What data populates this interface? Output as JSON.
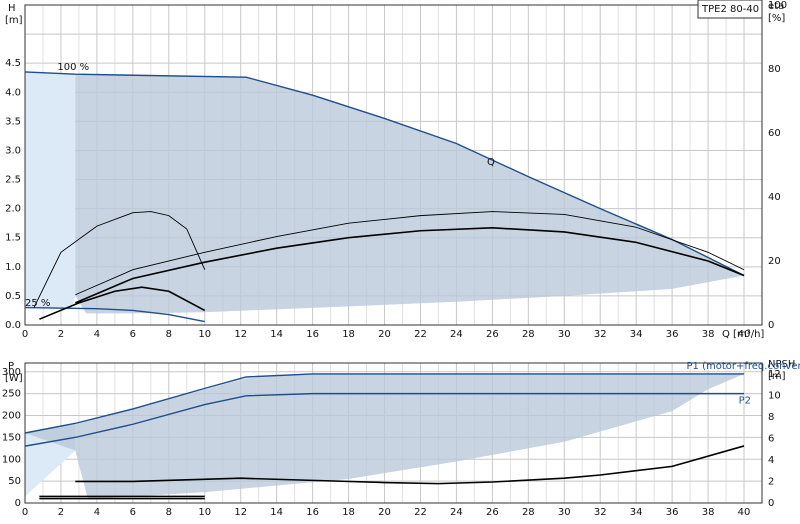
{
  "pump_model": "TPE2 80-40",
  "chart_data": [
    {
      "type": "line",
      "panel": "head",
      "x_label": "Q [m³/h]",
      "x_ticks": [
        0,
        2,
        4,
        6,
        8,
        10,
        12,
        14,
        16,
        18,
        20,
        22,
        24,
        26,
        28,
        30,
        32,
        34,
        36,
        38,
        40
      ],
      "xlim": [
        0,
        41
      ],
      "y_label_line1": "H",
      "y_label_line2": "[m]",
      "y_ticks": [
        0.0,
        0.5,
        1.0,
        1.5,
        2.0,
        2.5,
        3.0,
        3.5,
        4.0,
        4.5
      ],
      "ylim": [
        0,
        5.5
      ],
      "y2_label_line1": "eta",
      "y2_label_line2": "[%]",
      "y2_ticks": [
        0,
        20,
        40,
        60,
        80,
        100
      ],
      "y2lim": [
        0,
        100
      ],
      "annotations": [
        {
          "text": "100 %",
          "x": 1.8,
          "y": 4.38
        },
        {
          "text": "25 %",
          "x": 0.0,
          "y": 0.33
        },
        {
          "text": "Q",
          "x": 25.7,
          "y": 2.75
        }
      ],
      "region_boundary": [
        [
          2.8,
          4.31
        ],
        [
          12.3,
          4.26
        ],
        [
          16,
          3.95
        ],
        [
          20,
          3.55
        ],
        [
          24,
          3.12
        ],
        [
          28,
          2.55
        ],
        [
          32,
          2.0
        ],
        [
          36,
          1.47
        ],
        [
          40,
          0.85
        ],
        [
          36,
          0.62
        ],
        [
          30,
          0.5
        ],
        [
          24,
          0.4
        ],
        [
          18,
          0.32
        ],
        [
          10,
          0.22
        ],
        [
          6,
          0.2
        ],
        [
          3.4,
          0.2
        ],
        [
          2.8,
          0.5
        ],
        [
          2.8,
          4.31
        ]
      ],
      "series": [
        {
          "role": "max_curve",
          "points": [
            [
              0,
              4.35
            ],
            [
              2.8,
              4.31
            ],
            [
              12.3,
              4.26
            ],
            [
              16,
              3.95
            ],
            [
              20,
              3.55
            ],
            [
              24,
              3.12
            ],
            [
              28,
              2.55
            ],
            [
              32,
              2.0
            ],
            [
              36,
              1.47
            ],
            [
              40,
              0.85
            ]
          ]
        },
        {
          "role": "min_curve",
          "points": [
            [
              0,
              0.3
            ],
            [
              4,
              0.28
            ],
            [
              6,
              0.25
            ],
            [
              8,
              0.18
            ],
            [
              10,
              0.06
            ]
          ]
        },
        {
          "role": "eta_p1",
          "points": [
            [
              2.8,
              0.38
            ],
            [
              6,
              0.8
            ],
            [
              10,
              1.08
            ],
            [
              14,
              1.32
            ],
            [
              18,
              1.5
            ],
            [
              22,
              1.62
            ],
            [
              26,
              1.67
            ],
            [
              30,
              1.6
            ],
            [
              34,
              1.42
            ],
            [
              38,
              1.1
            ],
            [
              40,
              0.85
            ]
          ]
        },
        {
          "role": "eta_p2",
          "points": [
            [
              2.8,
              0.52
            ],
            [
              6,
              0.95
            ],
            [
              10,
              1.25
            ],
            [
              14,
              1.52
            ],
            [
              18,
              1.75
            ],
            [
              22,
              1.88
            ],
            [
              26,
              1.95
            ],
            [
              30,
              1.9
            ],
            [
              34,
              1.68
            ],
            [
              38,
              1.25
            ],
            [
              40,
              0.95
            ]
          ]
        },
        {
          "role": "eta_p1_min",
          "points": [
            [
              0.8,
              0.1
            ],
            [
              3,
              0.38
            ],
            [
              5,
              0.58
            ],
            [
              6.5,
              0.65
            ],
            [
              8,
              0.58
            ],
            [
              10,
              0.25
            ]
          ]
        },
        {
          "role": "eta_p2_min",
          "points": [
            [
              0.5,
              0.3
            ],
            [
              2,
              1.25
            ],
            [
              4,
              1.7
            ],
            [
              6,
              1.93
            ],
            [
              7,
              1.95
            ],
            [
              8,
              1.88
            ],
            [
              9,
              1.65
            ],
            [
              10,
              0.95
            ]
          ]
        }
      ]
    },
    {
      "type": "line",
      "panel": "power",
      "x_ticks": [
        0,
        2,
        4,
        6,
        8,
        10,
        12,
        14,
        16,
        18,
        20,
        22,
        24,
        26,
        28,
        30,
        32,
        34,
        36,
        38,
        40
      ],
      "xlim": [
        0,
        41
      ],
      "y_label_line1": "P",
      "y_label_line2": "[W]",
      "y_ticks": [
        0,
        50,
        100,
        150,
        200,
        250,
        300
      ],
      "ylim": [
        0,
        320
      ],
      "y2_label_line1": "NPSH",
      "y2_label_line2": "[m]",
      "y2_ticks": [
        0,
        2,
        4,
        6,
        8,
        10,
        12
      ],
      "y2lim": [
        0,
        13
      ],
      "legend": [
        {
          "text": "P1 (motor+freq.converter)",
          "x": 36.8,
          "y": 306
        },
        {
          "text": "P2",
          "x": 39.7,
          "y": 228
        }
      ],
      "region_boundary": [
        [
          0,
          160
        ],
        [
          2.8,
          180
        ],
        [
          12.3,
          285
        ],
        [
          16,
          295
        ],
        [
          40,
          295
        ],
        [
          38,
          260
        ],
        [
          36,
          210
        ],
        [
          30,
          140
        ],
        [
          24,
          95
        ],
        [
          18,
          55
        ],
        [
          10,
          25
        ],
        [
          6,
          15
        ],
        [
          3.5,
          8
        ],
        [
          2.8,
          120
        ],
        [
          0,
          160
        ]
      ],
      "series": [
        {
          "role": "P1",
          "points": [
            [
              0,
              160
            ],
            [
              2.8,
              182
            ],
            [
              6,
              215
            ],
            [
              10,
              262
            ],
            [
              12.3,
              288
            ],
            [
              16,
              295
            ],
            [
              40,
              295
            ]
          ]
        },
        {
          "role": "P2",
          "points": [
            [
              0,
              130
            ],
            [
              2.8,
              150
            ],
            [
              6,
              180
            ],
            [
              10,
              225
            ],
            [
              12.3,
              245
            ],
            [
              16,
              250
            ],
            [
              38,
              250
            ],
            [
              40,
              250
            ]
          ]
        },
        {
          "role": "P1_min",
          "points": [
            [
              0.8,
              15
            ],
            [
              10,
              15
            ]
          ]
        },
        {
          "role": "P2_min",
          "points": [
            [
              0.8,
              10
            ],
            [
              10,
              10
            ]
          ]
        },
        {
          "role": "NPSH",
          "points": [
            [
              2.8,
              2.0
            ],
            [
              6,
              2.0
            ],
            [
              12,
              2.3
            ],
            [
              16,
              2.1
            ],
            [
              20,
              1.9
            ],
            [
              23,
              1.8
            ],
            [
              26,
              1.95
            ],
            [
              30,
              2.3
            ],
            [
              32,
              2.6
            ],
            [
              36,
              3.4
            ],
            [
              40,
              5.3
            ]
          ]
        }
      ]
    }
  ]
}
